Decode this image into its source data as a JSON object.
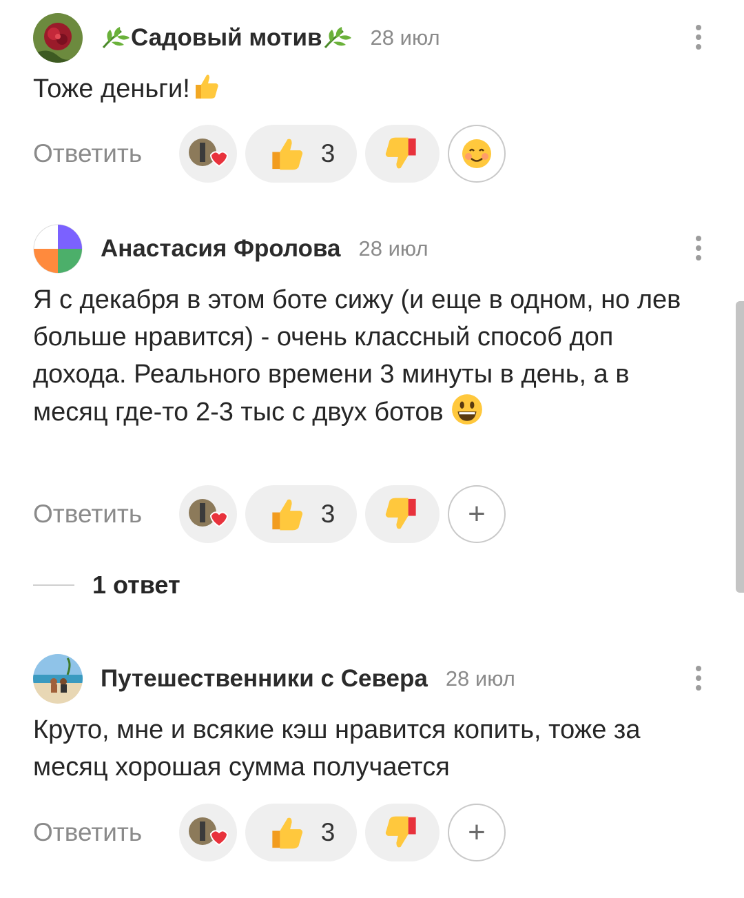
{
  "comments": [
    {
      "author": "Садовый мотив",
      "date": "28 июл",
      "text": "Тоже деньги!",
      "reply_label": "Ответить",
      "likes": "3",
      "extra_reaction": "smile-emoji"
    },
    {
      "author": "Анастасия Фролова",
      "date": "28 июл",
      "text": "Я с декабря в этом боте сижу (и еще в одном, но лев больше нравится) - очень классный способ доп дохода. Реального времени 3 минуты в день, а в месяц где-то 2-3 тыс с двух ботов",
      "reply_label": "Ответить",
      "likes": "3",
      "extra_reaction": "plus"
    },
    {
      "author": "Путешественники с Севера",
      "date": "28 июл",
      "text": "Круто, мне и всякие кэш нравится копить, тоже за месяц хорошая сумма получается",
      "reply_label": "Ответить",
      "likes": "3",
      "extra_reaction": "plus"
    }
  ],
  "thread": {
    "label": "1 ответ"
  },
  "plus_symbol": "+",
  "colors": {
    "reaction_bg": "#efefef",
    "meta_gray": "#8a8a8a"
  }
}
